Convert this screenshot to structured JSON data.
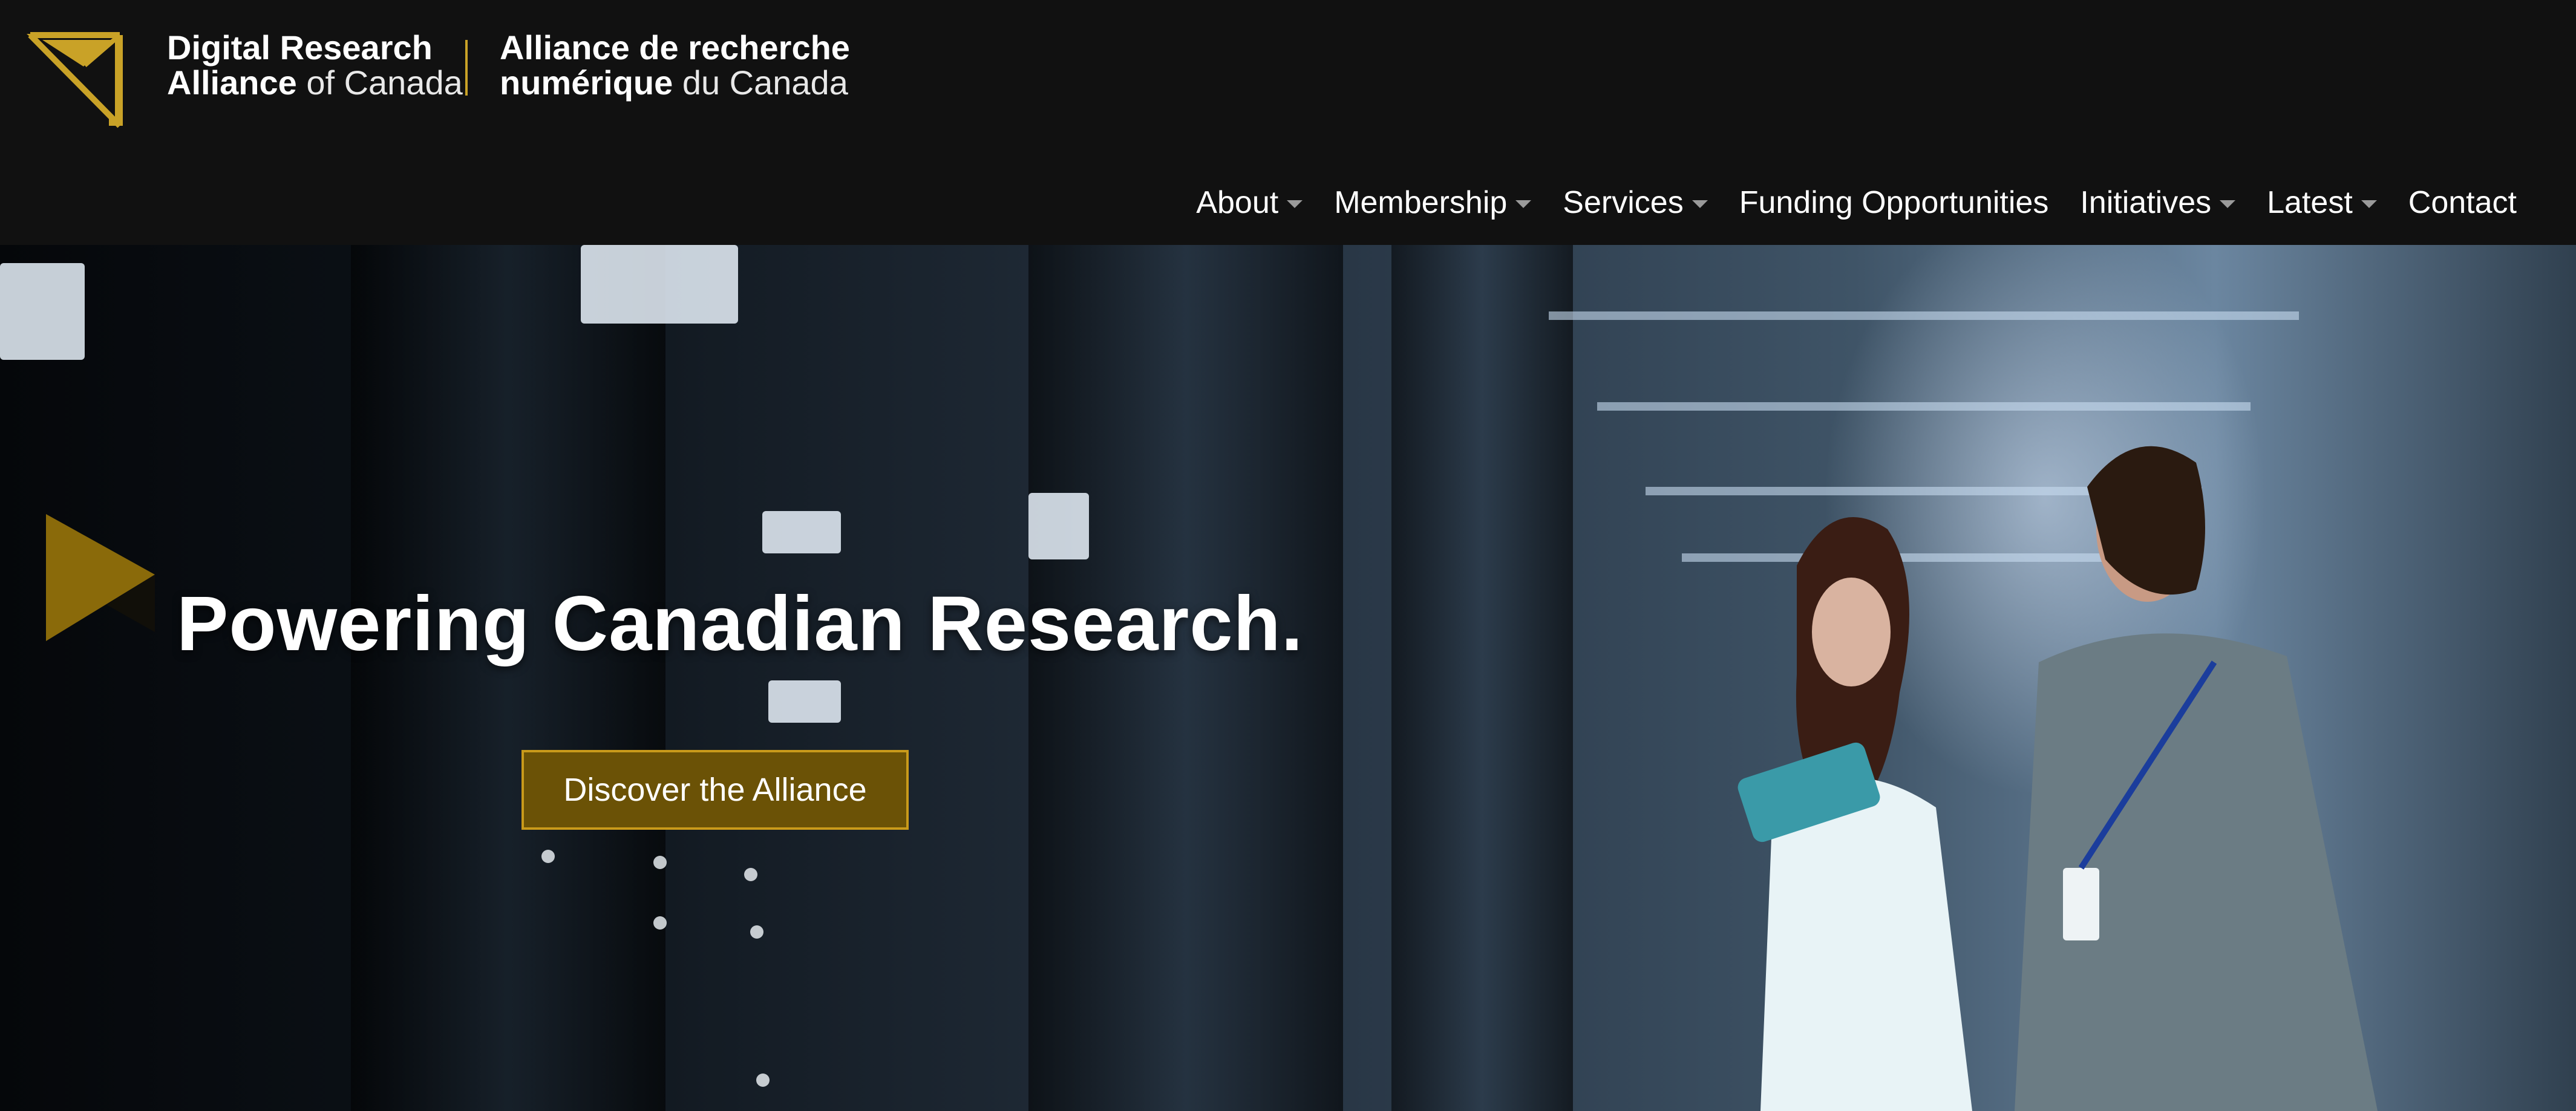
{
  "header": {
    "logo_en_line1": "Digital Research",
    "logo_en_line2_bold": "Alliance",
    "logo_en_line2_light": " of Canada",
    "logo_fr_line1": "Alliance de recherche",
    "logo_fr_line2_bold": "numérique",
    "logo_fr_line2_light": " du Canada"
  },
  "nav": {
    "items": [
      {
        "label": "About",
        "has_dropdown": true
      },
      {
        "label": "Membership",
        "has_dropdown": true
      },
      {
        "label": "Services",
        "has_dropdown": true
      },
      {
        "label": "Funding Opportunities",
        "has_dropdown": false
      },
      {
        "label": "Initiatives",
        "has_dropdown": true
      },
      {
        "label": "Latest",
        "has_dropdown": true
      },
      {
        "label": "Contact",
        "has_dropdown": false
      }
    ]
  },
  "hero": {
    "title": "Powering Canadian Research.",
    "cta_label": "Discover the Alliance",
    "image_icon": "data-center-photo"
  },
  "colors": {
    "header_bg": "#111111",
    "accent_gold": "#c9a227",
    "cta_bg": "#6b5206",
    "arrow_gold": "#8a6a0a"
  }
}
